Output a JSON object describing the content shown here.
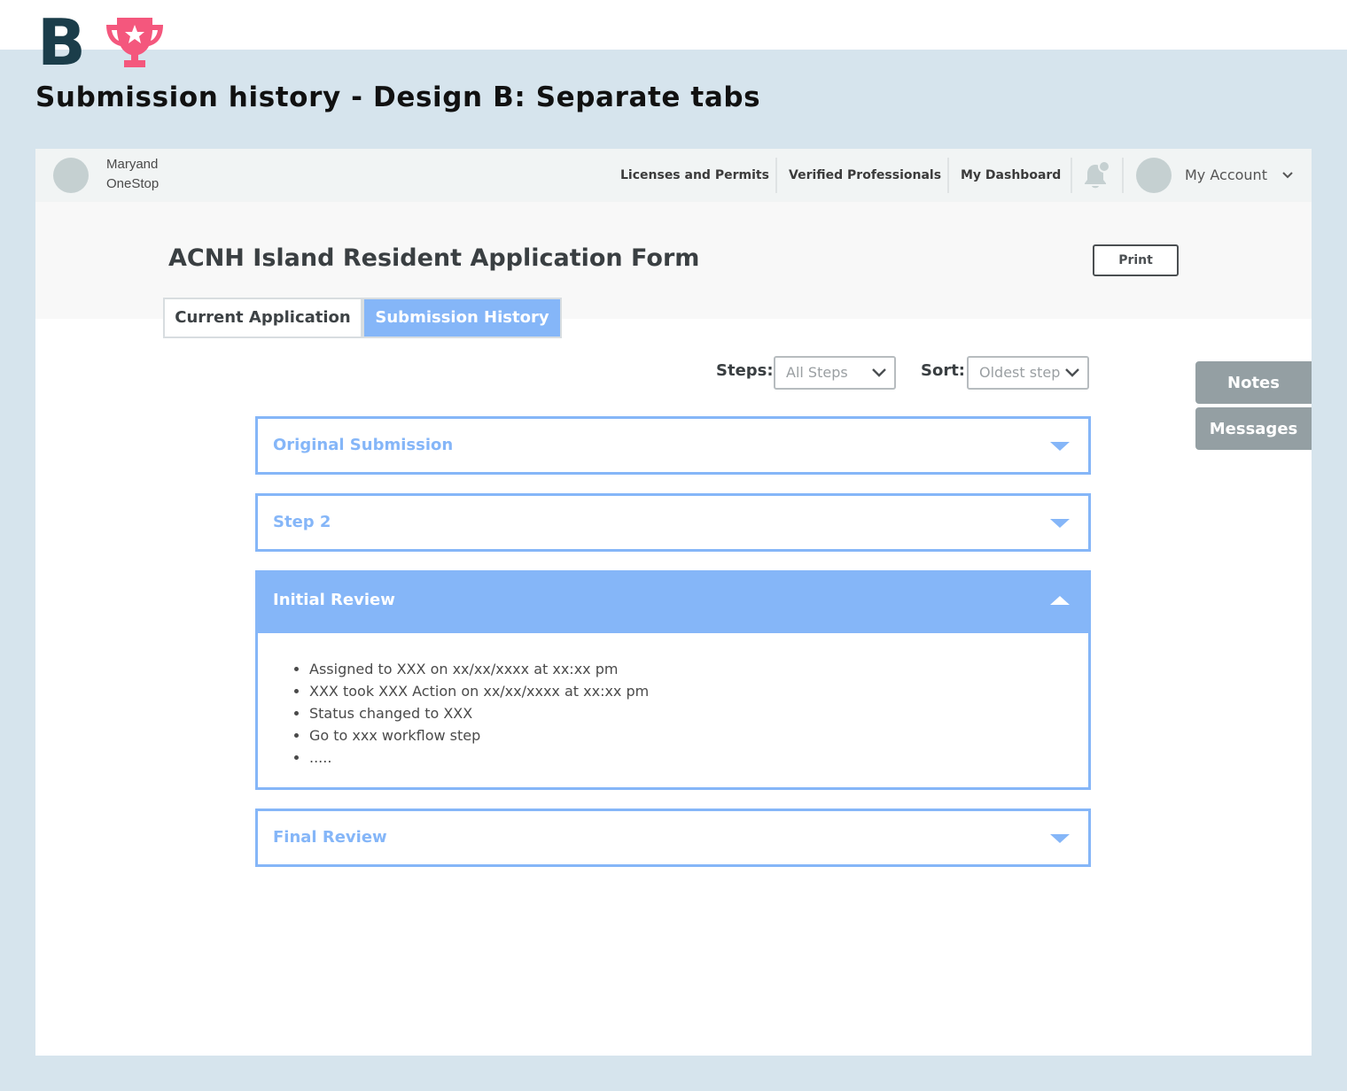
{
  "design": {
    "letter": "B",
    "title": "Submission history - Design B: Separate tabs"
  },
  "navbar": {
    "brand_line1": "Maryand",
    "brand_line2": "OneStop",
    "links": [
      "Licenses and Permits",
      "Verified Professionals",
      "My Dashboard"
    ],
    "account_label": "My Account"
  },
  "form": {
    "title": "ACNH Island Resident Application Form",
    "print_label": "Print"
  },
  "tabs": {
    "current": "Current Application",
    "history": "Submission History"
  },
  "filters": {
    "steps_label": "Steps:",
    "steps_value": "All Steps",
    "sort_label": "Sort:",
    "sort_value": "Oldest step"
  },
  "side_buttons": {
    "notes": "Notes",
    "messages": "Messages"
  },
  "accordion": [
    {
      "label": "Original Submission",
      "expanded": false
    },
    {
      "label": "Step 2",
      "expanded": false
    },
    {
      "label": "Initial Review",
      "expanded": true
    },
    {
      "label": "Final Review",
      "expanded": false
    }
  ],
  "initial_review_items": [
    "Assigned to XXX on xx/xx/xxxx at xx:xx pm",
    "XXX took XXX Action on xx/xx/xxxx at xx:xx pm",
    "Status changed to XXX",
    "Go to xxx workflow step",
    "....."
  ],
  "colors": {
    "accent": "#85b6f8",
    "logo_dark": "#1b3d4a",
    "trophy": "#f4577d",
    "side_button": "#949fa3",
    "background": "#d6e4ed"
  },
  "icons": {
    "trophy": "trophy-icon",
    "bell": "bell-icon",
    "chevron": "chevron-down-icon",
    "caret_down": "caret-down-icon",
    "caret_up": "caret-up-icon"
  }
}
